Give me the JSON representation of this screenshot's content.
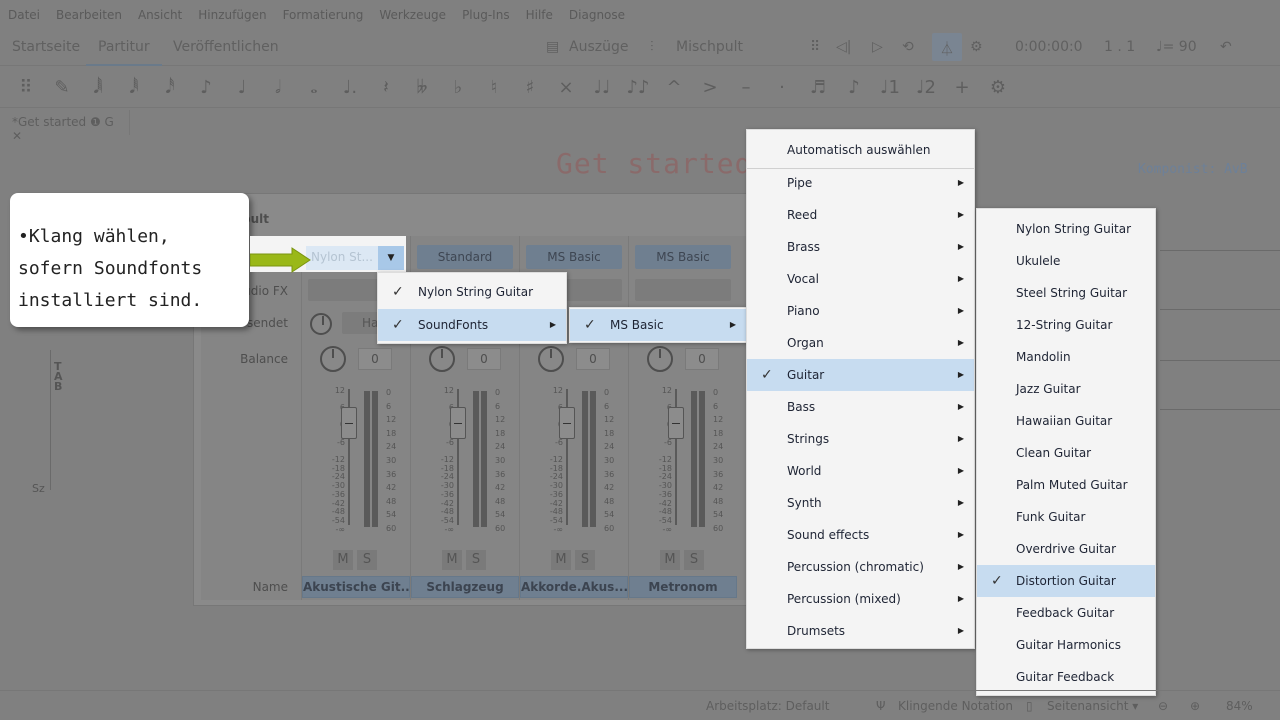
{
  "menubar": [
    "Datei",
    "Bearbeiten",
    "Ansicht",
    "Hinzufügen",
    "Formatierung",
    "Werkzeuge",
    "Plug-Ins",
    "Hilfe",
    "Diagnose"
  ],
  "tabs": {
    "home": "Startseite",
    "score": "Partitur",
    "publish": "Veröffentlichen",
    "parts": "Auszüge",
    "mixer": "Mischpult",
    "time": "0:00:00:0",
    "position": "1 . 1",
    "tempo": "♩= 90"
  },
  "toolbar_glyphs": [
    "⠿",
    "✎",
    "𝅘𝅥𝅲",
    "𝅘𝅥𝅱",
    "𝅘𝅥𝅰",
    "♪",
    "♩",
    "𝅗𝅥",
    "𝅝",
    "♩.",
    "𝄽",
    "𝄫",
    "♭",
    "♮",
    "♯",
    "×",
    "♩♩",
    "♪♪",
    "^",
    ">",
    "–",
    "·",
    "♬",
    "♪",
    "♩1",
    "♩2",
    "+",
    "⚙"
  ],
  "doc_tab": "*Get started ❶ G  ✕",
  "score": {
    "title": "Get started",
    "composer": "Komponist: AvB"
  },
  "mixer": {
    "title": "pult",
    "row_labels": {
      "sound": "",
      "audio_fx": "udio FX",
      "send": "sendet",
      "balance": "Balance",
      "name": "Name"
    },
    "send_button": "Ha",
    "left_scale": [
      "12",
      "6",
      "0",
      "-6",
      "-12",
      "-18",
      "-24",
      "-30",
      "-36",
      "-42",
      "-48",
      "-54",
      "-∞"
    ],
    "right_scale": [
      "0",
      "6",
      "12",
      "18",
      "24",
      "30",
      "36",
      "42",
      "48",
      "54",
      "60"
    ],
    "mute": "M",
    "solo": "S",
    "channels": [
      {
        "name": "Akustische Git...",
        "sound": "Nylon St...",
        "balance": "0"
      },
      {
        "name": "Schlagzeug",
        "sound": "Standard",
        "balance": "0"
      },
      {
        "name": "Akkorde.Akus...",
        "sound": "MS Basic",
        "balance": "0"
      },
      {
        "name": "Metronom",
        "sound": "MS Basic",
        "balance": "0"
      }
    ]
  },
  "callout": {
    "text": "•Klang wählen, sofern Soundfonts installiert sind."
  },
  "menu_sound": {
    "items": [
      {
        "label": "Nylon String Guitar",
        "checked": true
      },
      {
        "label": "SoundFonts",
        "checked": true,
        "submenu": true,
        "selected": true
      }
    ]
  },
  "menu_soundfonts": {
    "items": [
      {
        "label": "MS Basic",
        "checked": true,
        "submenu": true,
        "selected": true
      }
    ]
  },
  "menu_categories": {
    "auto": "Automatisch auswählen",
    "items": [
      "Pipe",
      "Reed",
      "Brass",
      "Vocal",
      "Piano",
      "Organ",
      "Guitar",
      "Bass",
      "Strings",
      "World",
      "Synth",
      "Sound effects",
      "Percussion (chromatic)",
      "Percussion (mixed)",
      "Drumsets"
    ],
    "selected": "Guitar"
  },
  "menu_guitars": {
    "items": [
      "Nylon String Guitar",
      "Ukulele",
      "Steel String Guitar",
      "12-String Guitar",
      "Mandolin",
      "Jazz Guitar",
      "Hawaiian Guitar",
      "Clean Guitar",
      "Palm Muted Guitar",
      "Funk Guitar",
      "Overdrive Guitar",
      "Distortion Guitar",
      "Feedback Guitar",
      "Guitar Harmonics",
      "Guitar Feedback"
    ],
    "selected": "Distortion Guitar"
  },
  "statusbar": {
    "workspace": "Arbeitsplatz: Default",
    "concert": "Klingende Notation",
    "view": "Seitenansicht ▾",
    "zoom": "84%"
  },
  "colors": {
    "highlight": "#c7dcf0",
    "arrow": "#9ab818",
    "dim_overlay": "#808080"
  }
}
